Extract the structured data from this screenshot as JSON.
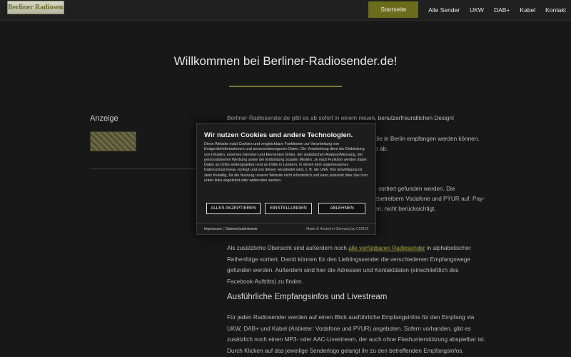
{
  "header": {
    "logo_text": "Berliner Radiosender",
    "nav": [
      "Startseite",
      "Alle Sender",
      "UKW",
      "DAB+",
      "Kabel",
      "Kontakt"
    ]
  },
  "main": {
    "title": "Willkommen bei Berliner-Radiosender.de!",
    "intro": "Berliner-Radiosender.de gibt es ab sofort in einem neuen, benutzerfreundlichen Design!",
    "frag1": "die in Berlin empfangen werden können.",
    "frag2": "o ab.",
    "frag3": ") sortiert gefunden werden. Die",
    "frag4": "zbetreibern Vodafone und PŸUR auf. Pay-",
    "frag5": "en, nicht berücksichtigt.",
    "overview_before": "Als zusätzliche Übersicht sind außerdem noch ",
    "overview_link": "alle verfügbaren Radiosender",
    "overview_after": " in alphabetischer Reihenfolge sortiert. Damit können für den Lieblingssender die verschiedenen Empfangswege gefunden werden. Außerdem sind hier die Adressen und Kontaktdaten (einschließlich des Facebook-Auftritts) zu finden.",
    "section_heading": "Ausführliche Empfangsinfos und Livestream",
    "section_text": "Für jeden Radiosender werden auf einen Blick ausführliche Empfangsinfos für den Empfang via UKW, DAB+ und Kabel (Anbieter: Vodafone und PŸUR) angeboten. Sofern vorhanden, gibt es zusätzlich noch einen MP3- oder AAC-Livestream, der auch ohne Flashunterstützung abspielbar ist. Durch Klicken auf das jeweilige Senderlogo gelangt ihr zu den betreffenden Empfangsinfos."
  },
  "aside": {
    "heading": "Anzeige"
  },
  "cookie_modal": {
    "title": "Wir nutzen Cookies und andere Technologien.",
    "text": "Diese Website nutzt Cookies und vergleichbare Funktionen zur Verarbeitung von Endgeräteinformationen und personenbezogenen Daten. Die Verarbeitung dient der Einbindung von Inhalten, externen Diensten und Elementen Dritter, der statistischen Analyse/Messung, der personalisierten Werbung sowie der Einbindung sozialer Medien. Je nach Funktion werden dabei Daten an Dritte weitergegeben und an Dritte in Ländern, in denen kein angemessenes Datenschutzniveau vorliegt und von diesen verarbeitet wird, z. B. die USA. Ihre Einwilligung ist stets freiwillig, für die Nutzung unserer Website nicht erforderlich und kann jederzeit über das Icon unten links abgelehnt oder widerrufen werden.",
    "accept": "ALLES AKZEPTIEREN",
    "settings": "EINSTELLUNGEN",
    "decline": "ABLEHNEN",
    "imprint": "Impressum",
    "privacy": "Datenschutzhinweis",
    "hosted": "Made & Hosted in Germany by CCM19"
  },
  "colors": {
    "background": "#181818",
    "accent": "#6b6b1c",
    "link": "#a7a743"
  }
}
